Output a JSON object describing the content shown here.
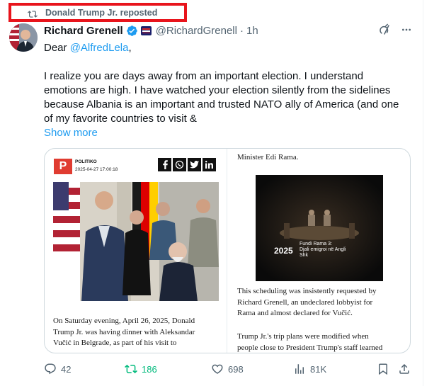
{
  "repost": {
    "label": "Donald Trump Jr. reposted",
    "icon": "repost-icon"
  },
  "author": {
    "name": "Richard Grenell",
    "handle": "@RichardGrenell",
    "time": "1h",
    "separator": "·",
    "verified": true,
    "affiliate_icon": "affiliate-badge-icon"
  },
  "tweet": {
    "greeting": "Dear ",
    "mention": "@AlfredLela",
    "greeting_end": ",",
    "lines": [
      "I realize you are days away from an important election. I understand",
      "emotions are high. I have watched your election silently from the sidelines",
      "because Albania is an important and trusted NATO ally of America (and one",
      "of my favorite countries to visit &"
    ],
    "show_more": "Show more"
  },
  "card": {
    "brand_letter": "P",
    "brand": "POLITIKO",
    "datetime": "2025-04-27 17:00:18",
    "share_icons": [
      "f",
      "W",
      "t",
      "in"
    ],
    "left_body": [
      "On Saturday evening, April 26, 2025, Donald",
      "Trump Jr. was having dinner with Aleksandar",
      "Vučić in Belgrade, as part of his visit to"
    ],
    "right_top": "Minister Edi Rama.",
    "video": {
      "year": "2025",
      "title": [
        "Fundi Rama 3:",
        "Djali emigroi në Angli",
        "Shk"
      ]
    },
    "right_body_1": [
      "This scheduling was insistently requested by",
      "Richard Grenell, an undeclared lobbyist for",
      "Rama and almost declared for Vučić."
    ],
    "right_body_2": [
      "Trump Jr.'s trip plans were modified when",
      "people close to President Trump's staff learned"
    ]
  },
  "actions": {
    "replies": "42",
    "reposts": "186",
    "likes": "698",
    "views": "81K"
  },
  "colors": {
    "link": "#1d9bf0",
    "repost_green": "#00ba7c",
    "highlight_box": "#e8141c"
  }
}
